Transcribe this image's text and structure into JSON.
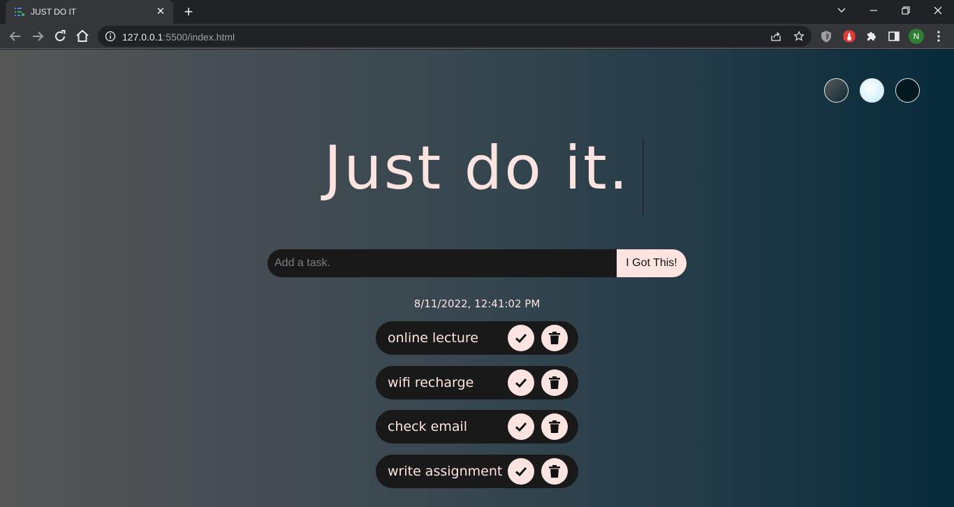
{
  "browser": {
    "tab_title": "JUST DO IT",
    "tab_close": "✕",
    "new_tab": "+",
    "url_host": "127.0.0.1",
    "url_path": ":5500/index.html",
    "profile_initial": "N"
  },
  "app": {
    "heading": "Just do it.",
    "input_placeholder": "Add a task.",
    "submit_label": "I Got This!",
    "datetime": "8/11/2022, 12:41:02 PM",
    "themes": [
      "standard",
      "light",
      "darker"
    ],
    "todos": [
      {
        "text": "online lecture"
      },
      {
        "text": "wifi recharge"
      },
      {
        "text": "check email"
      },
      {
        "text": "write assignment"
      }
    ]
  },
  "colors": {
    "accent": "#fde4e1",
    "item_bg": "#191919",
    "gradient_start": "#565656",
    "gradient_end": "#062a3a"
  }
}
